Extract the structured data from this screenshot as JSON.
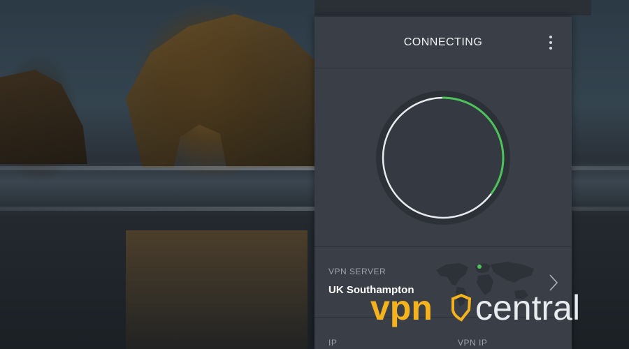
{
  "vpn": {
    "status": "CONNECTING",
    "server_label": "VPN SERVER",
    "server_value": "UK Southampton",
    "ip_label": "IP",
    "vpn_ip_label": "VPN IP",
    "progress_fraction": 0.35
  },
  "watermark": {
    "brand_part1": "vpn",
    "brand_part2": "central"
  },
  "colors": {
    "panel_bg": "#3a3f47",
    "accent_green": "#4cc35a",
    "watermark_yellow": "#f5b21f",
    "watermark_white": "#e9ecef"
  },
  "icons": {
    "menu": "vertical-dots-icon",
    "chevron": "chevron-right-icon",
    "map": "world-map-icon"
  }
}
